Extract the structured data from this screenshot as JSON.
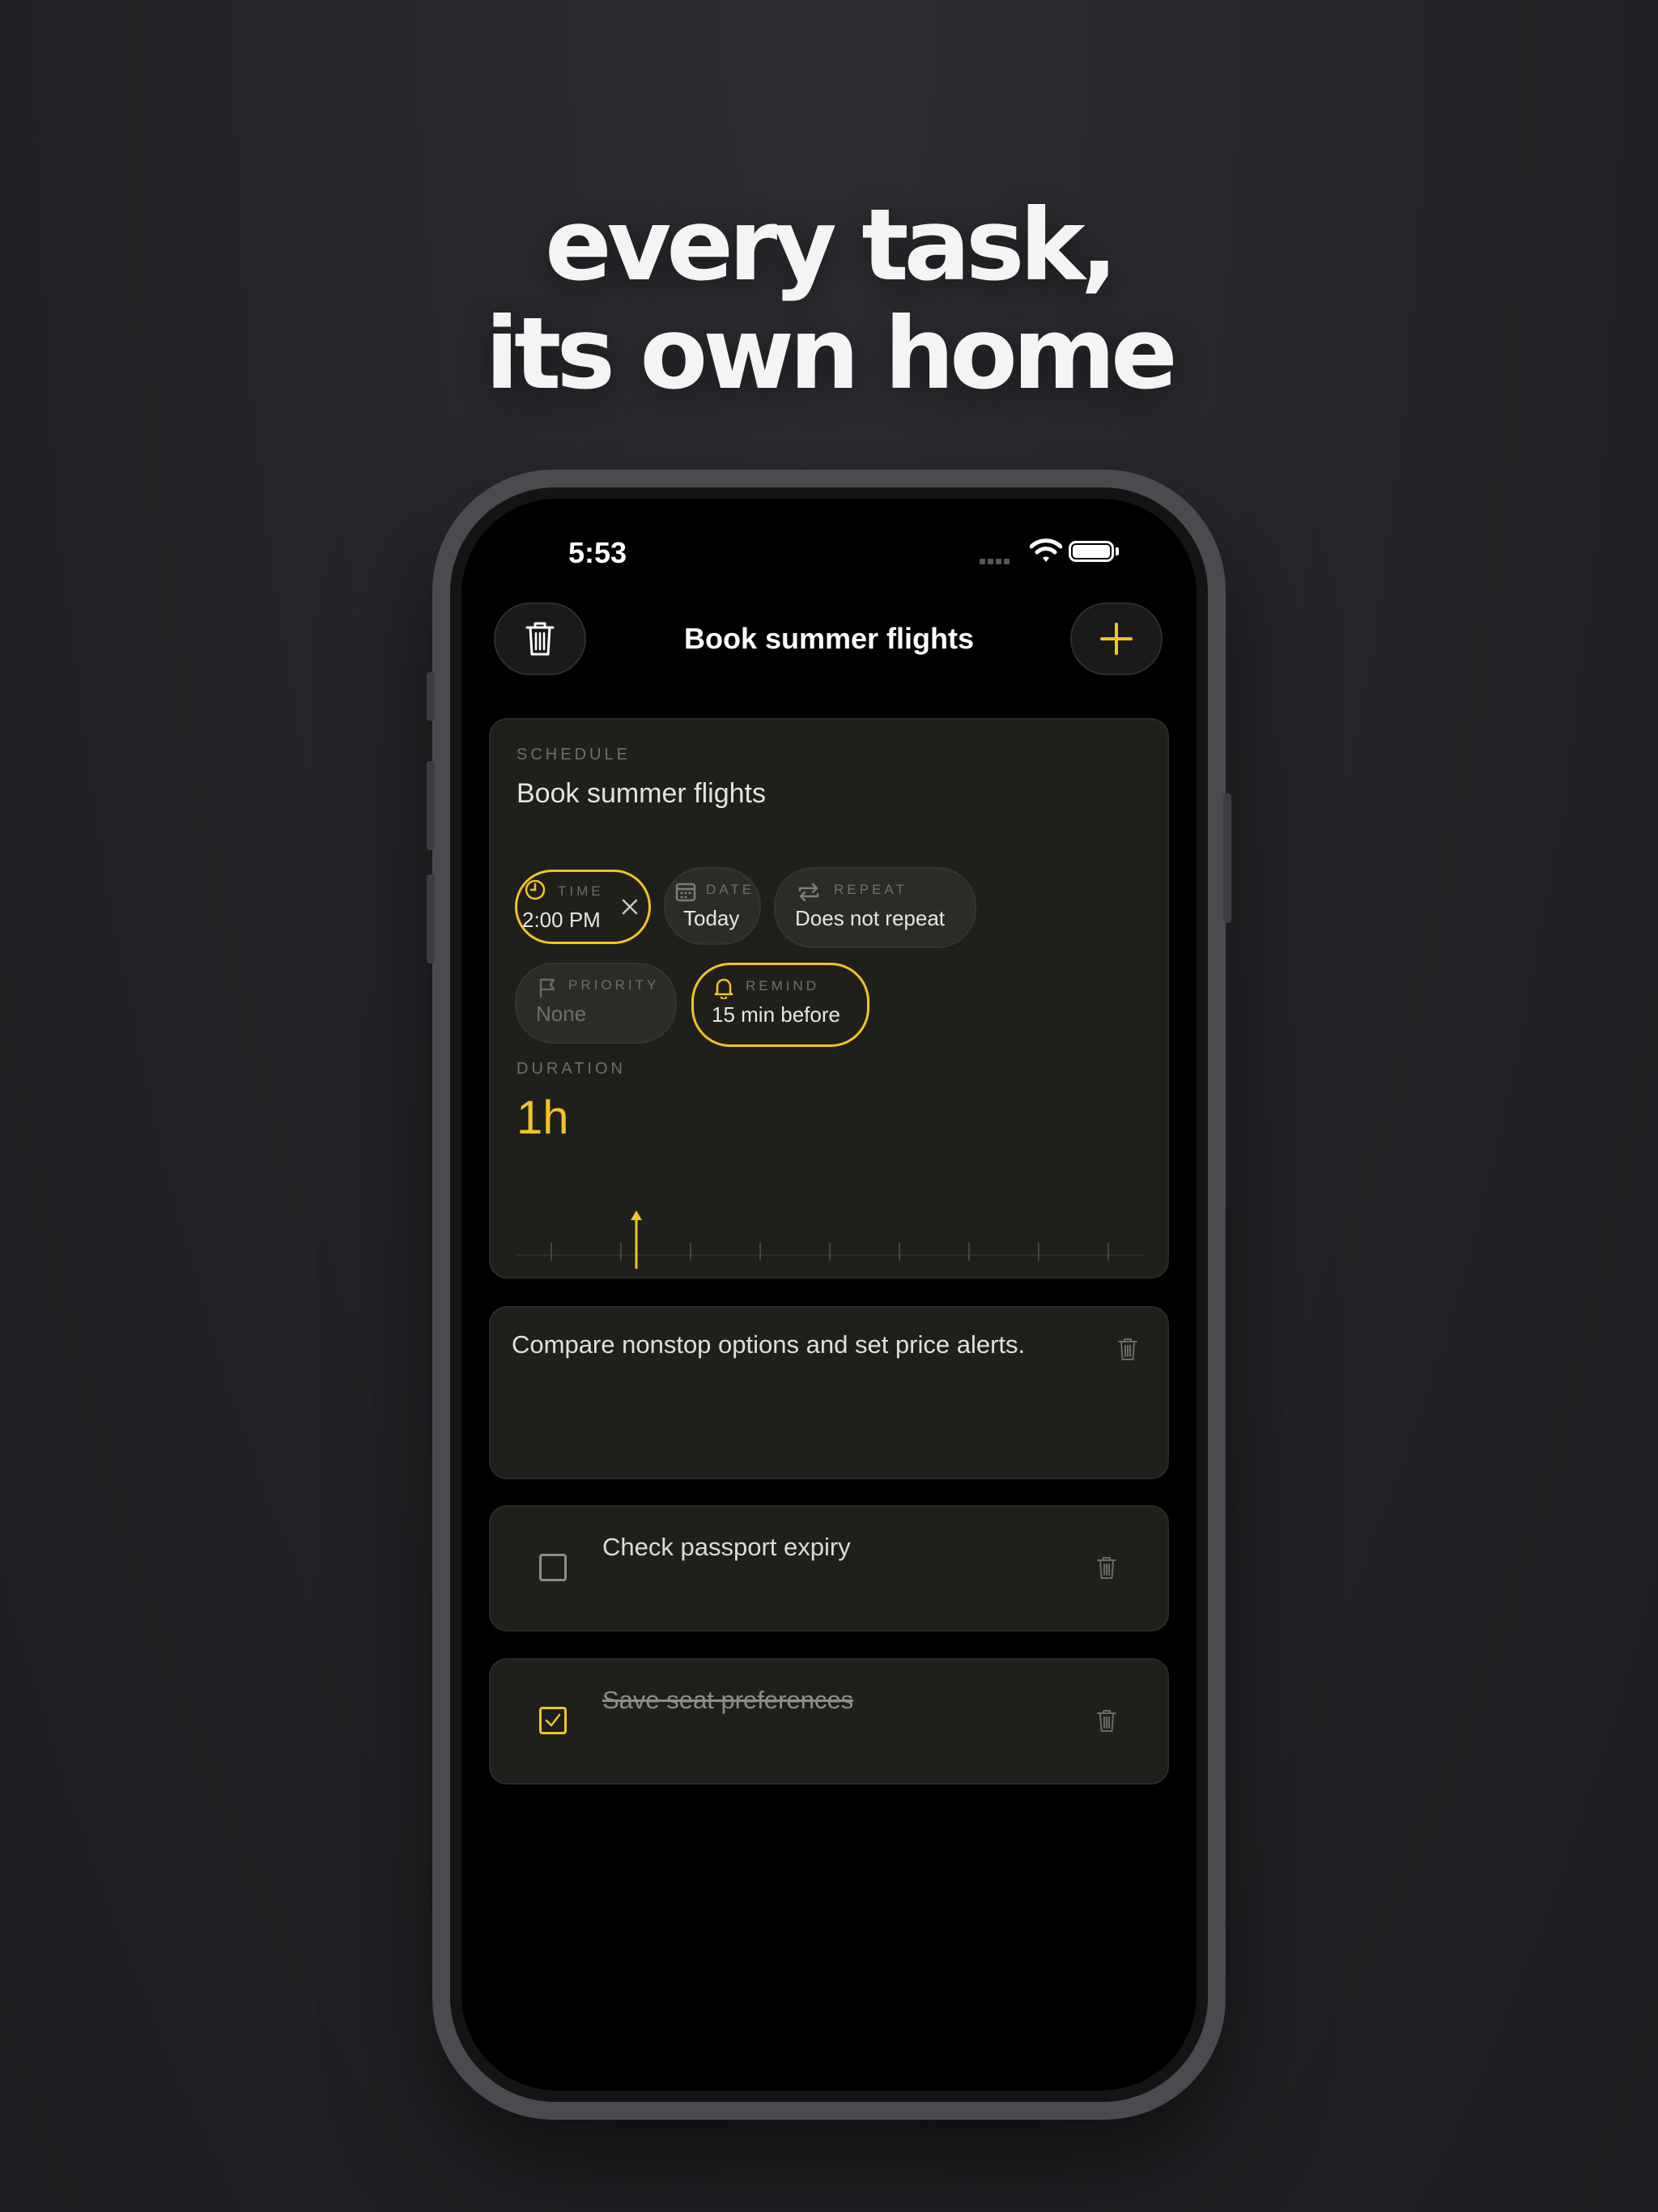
{
  "headline": {
    "line1": "every task,",
    "line2": "its own home"
  },
  "status_bar": {
    "time": "5:53"
  },
  "nav": {
    "title": "Book summer flights"
  },
  "schedule": {
    "section_label": "SCHEDULE",
    "task_title": "Book summer flights",
    "chips": {
      "time": {
        "label": "TIME",
        "value": "2:00 PM",
        "active": true
      },
      "date": {
        "label": "DATE",
        "value": "Today"
      },
      "repeat": {
        "label": "REPEAT",
        "value": "Does not repeat"
      },
      "priority": {
        "label": "PRIORITY",
        "value": "None"
      },
      "remind": {
        "label": "REMIND",
        "value": "15 min before",
        "active": true
      }
    },
    "duration": {
      "label": "DURATION",
      "value": "1h"
    }
  },
  "note": {
    "text": "Compare nonstop options and set price alerts."
  },
  "subtasks": [
    {
      "text": "Check passport expiry",
      "done": false
    },
    {
      "text": "Save seat preferences",
      "done": true
    }
  ],
  "colors": {
    "accent": "#f3c226",
    "background": "#232427",
    "card": "#1f1f1c"
  },
  "icons": [
    "trash-icon",
    "plus-icon",
    "clock-icon",
    "close-icon",
    "calendar-icon",
    "repeat-icon",
    "flag-icon",
    "bell-icon",
    "checkmark-icon",
    "wifi-icon",
    "battery-icon",
    "signal-icon"
  ]
}
